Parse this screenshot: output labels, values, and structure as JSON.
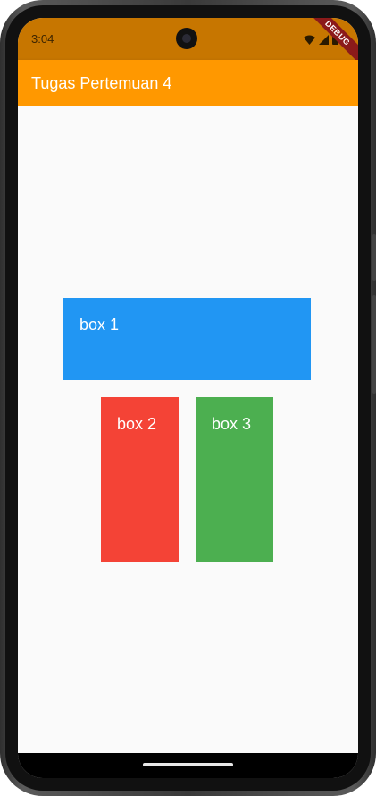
{
  "status_bar": {
    "time": "3:04",
    "icons": [
      "wifi-icon",
      "signal-icon",
      "battery-icon"
    ],
    "debug_banner": "DEBUG"
  },
  "app_bar": {
    "title": "Tugas Pertemuan 4",
    "color": "#FF9800"
  },
  "boxes": [
    {
      "label": "box 1",
      "color": "#2196F3"
    },
    {
      "label": "box 2",
      "color": "#F44336"
    },
    {
      "label": "box 3",
      "color": "#4CAF50"
    }
  ]
}
